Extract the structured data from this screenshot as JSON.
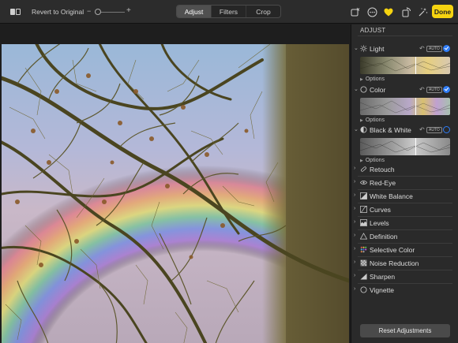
{
  "toolbar": {
    "revert_label": "Revert to Original",
    "zoom_minus": "−",
    "zoom_plus": "+",
    "tabs": [
      {
        "label": "Adjust",
        "active": true
      },
      {
        "label": "Filters",
        "active": false
      },
      {
        "label": "Crop",
        "active": false
      }
    ],
    "done_label": "Done",
    "icons": [
      "compare-icon",
      "info-icon",
      "more-icon",
      "favorite-heart-icon",
      "rotate-icon",
      "auto-enhance-icon"
    ]
  },
  "sidebar": {
    "title": "ADJUST",
    "expanded_sections": [
      {
        "label": "Light",
        "auto": "AUTO",
        "enabled": true,
        "options": "Options",
        "thumb": "color"
      },
      {
        "label": "Color",
        "auto": "AUTO",
        "enabled": true,
        "options": "Options",
        "thumb": "color"
      },
      {
        "label": "Black & White",
        "auto": "AUTO",
        "enabled": false,
        "options": "Options",
        "thumb": "mono"
      }
    ],
    "collapsed_sections": [
      {
        "label": "Retouch",
        "icon": "bandage-icon"
      },
      {
        "label": "Red-Eye",
        "icon": "eye-icon"
      },
      {
        "label": "White Balance",
        "icon": "white-balance-icon"
      },
      {
        "label": "Curves",
        "icon": "curves-icon"
      },
      {
        "label": "Levels",
        "icon": "levels-icon"
      },
      {
        "label": "Definition",
        "icon": "triangle-icon"
      },
      {
        "label": "Selective Color",
        "icon": "selective-color-icon"
      },
      {
        "label": "Noise Reduction",
        "icon": "noise-icon"
      },
      {
        "label": "Sharpen",
        "icon": "sharpen-icon"
      },
      {
        "label": "Vignette",
        "icon": "vignette-icon"
      }
    ],
    "reset_label": "Reset Adjustments"
  },
  "colors": {
    "accent": "#2f7cf6",
    "done": "#f5d310",
    "favorite": "#f5d310"
  }
}
